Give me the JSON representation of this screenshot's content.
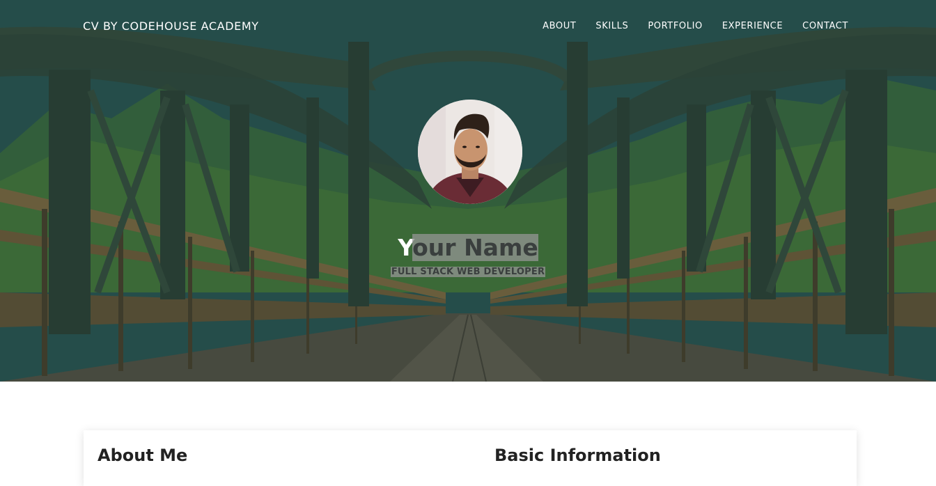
{
  "header": {
    "brand": "CV BY CODEHOUSE ACADEMY",
    "nav": [
      {
        "label": "ABOUT"
      },
      {
        "label": "SKILLS"
      },
      {
        "label": "PORTFOLIO"
      },
      {
        "label": "EXPERIENCE"
      },
      {
        "label": "CONTACT"
      }
    ]
  },
  "hero": {
    "name_first": "Y",
    "name_rest": "our Name",
    "title": "FULL STACK WEB DEVELOPER",
    "background": "bridge-landscape-image",
    "avatar": "profile-photo"
  },
  "sections": {
    "about_heading": "About Me",
    "basic_info_heading": "Basic Information"
  },
  "colors": {
    "hero_overlay": "#1f4a48",
    "text_light": "#ffffff",
    "selection": "#969696"
  }
}
